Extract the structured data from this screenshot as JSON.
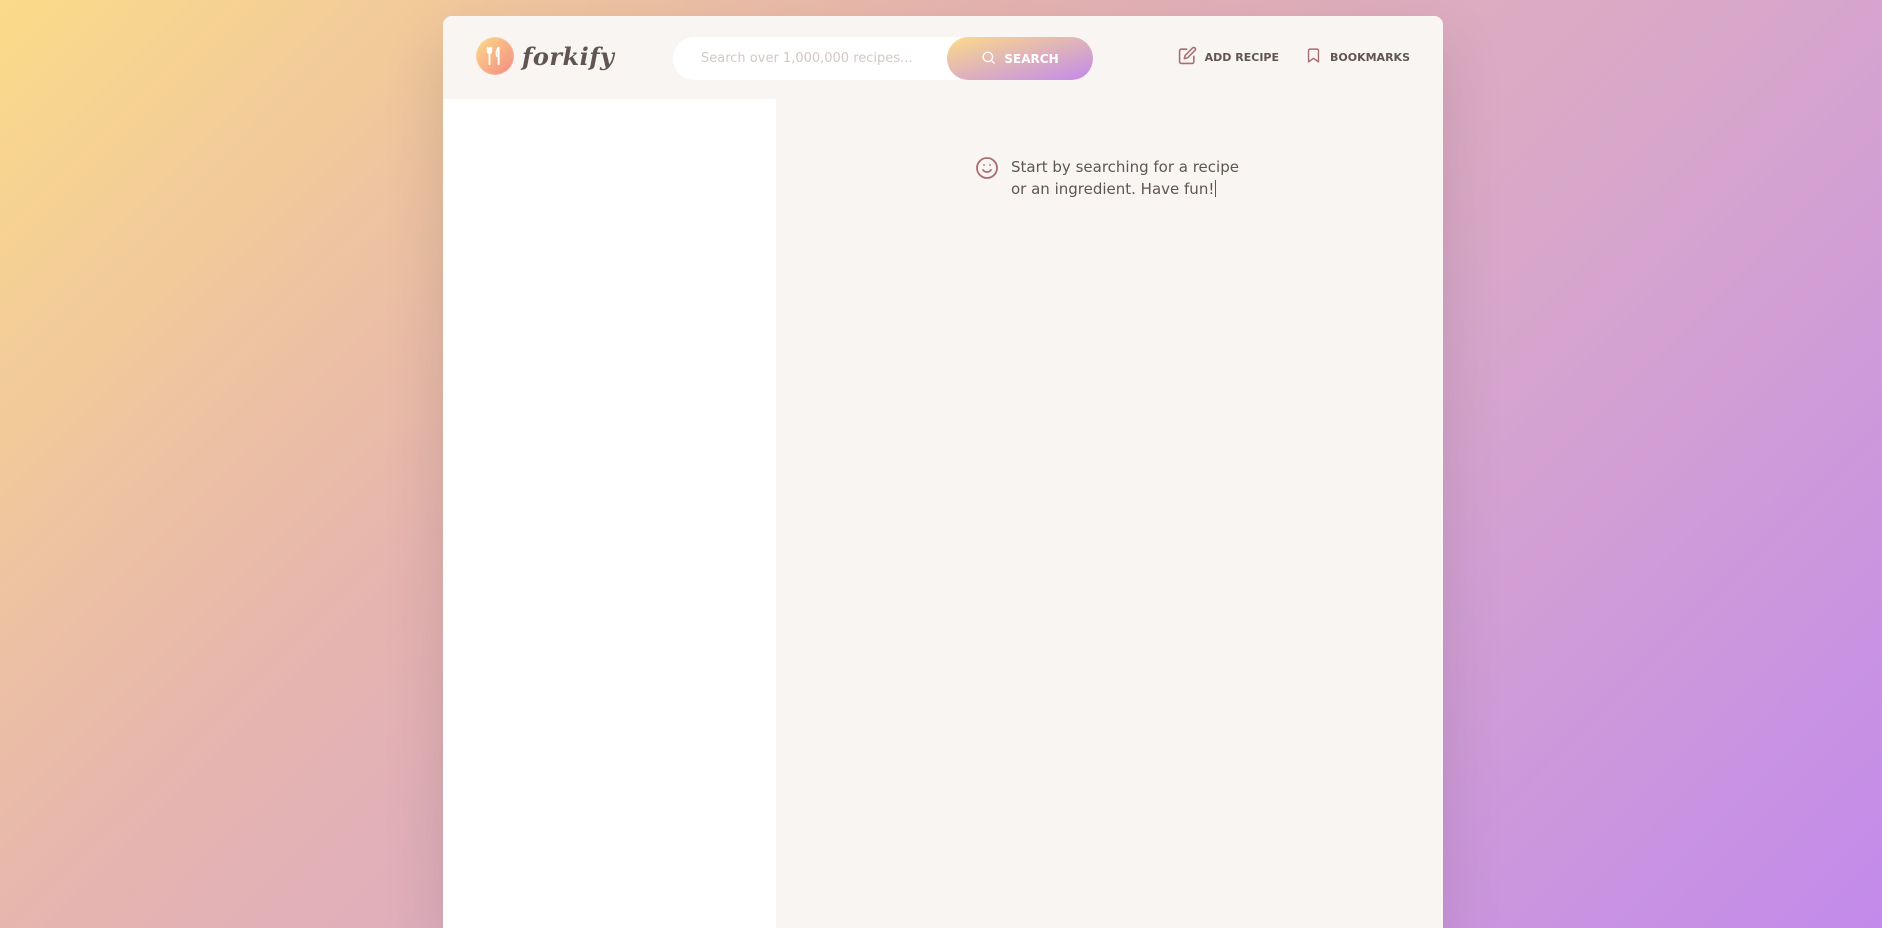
{
  "app": {
    "logo_text": "forkify"
  },
  "search": {
    "placeholder": "Search over 1,000,000 recipes...",
    "value": "",
    "button_label": "SEARCH"
  },
  "nav": {
    "add_recipe_label": "ADD RECIPE",
    "bookmarks_label": "BOOKMARKS"
  },
  "main": {
    "message": "Start by searching for a recipe or an ingredient. Have fun!"
  },
  "icons": {
    "logo": "fork-knife-icon",
    "search": "search-icon",
    "add_recipe": "edit-icon",
    "bookmarks": "bookmark-icon",
    "message": "smile-icon"
  },
  "colors": {
    "gradient_start": "#fbdb89",
    "gradient_end": "#c38aeb",
    "text": "#615551",
    "accent_icon": "#a76f6f"
  }
}
